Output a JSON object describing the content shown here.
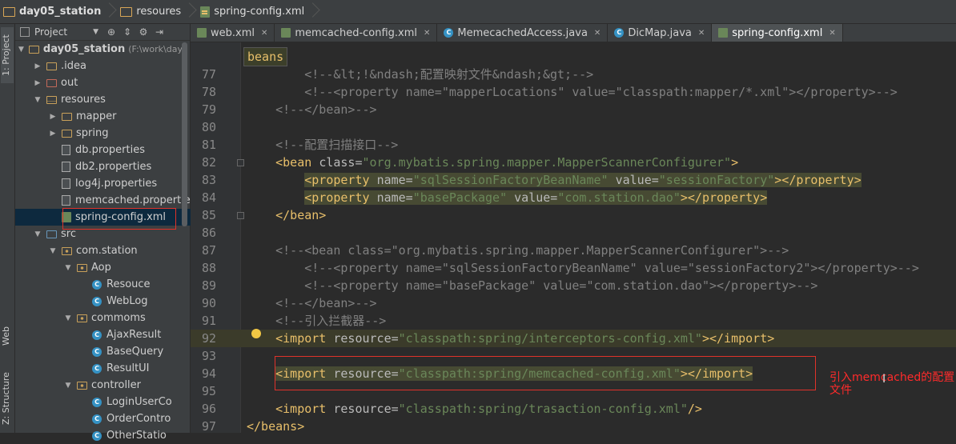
{
  "breadcrumb": {
    "project": "day05_station",
    "folder": "resoures",
    "file": "spring-config.xml"
  },
  "side_tabs": {
    "project": "1: Project",
    "web": "Web",
    "structure": "Z: Structure"
  },
  "project_panel": {
    "view_select": "Project",
    "tree": [
      {
        "label": "day05_station",
        "hint": "(F:\\work\\day0",
        "kind": "module",
        "arrow": "down"
      },
      {
        "label": ".idea",
        "kind": "folder",
        "arrow": "right"
      },
      {
        "label": "out",
        "kind": "out",
        "arrow": "right"
      },
      {
        "label": "resoures",
        "kind": "res",
        "arrow": "down"
      },
      {
        "label": "mapper",
        "kind": "folder",
        "arrow": "right"
      },
      {
        "label": "spring",
        "kind": "folder",
        "arrow": "right"
      },
      {
        "label": "db.properties",
        "kind": "prop",
        "arrow": "none"
      },
      {
        "label": "db2.properties",
        "kind": "prop",
        "arrow": "none"
      },
      {
        "label": "log4j.properties",
        "kind": "prop",
        "arrow": "none"
      },
      {
        "label": "memcached.propertie",
        "kind": "prop",
        "arrow": "none"
      },
      {
        "label": "spring-config.xml",
        "kind": "xml",
        "arrow": "none",
        "selected": true
      },
      {
        "label": "src",
        "kind": "src",
        "arrow": "down"
      },
      {
        "label": "com.station",
        "kind": "pkg",
        "arrow": "down"
      },
      {
        "label": "Aop",
        "kind": "pkg",
        "arrow": "down"
      },
      {
        "label": "Resouce",
        "kind": "class",
        "arrow": "none"
      },
      {
        "label": "WebLog",
        "kind": "class",
        "arrow": "none"
      },
      {
        "label": "commoms",
        "kind": "pkg",
        "arrow": "down"
      },
      {
        "label": "AjaxResult",
        "kind": "class",
        "arrow": "none"
      },
      {
        "label": "BaseQuery",
        "kind": "class",
        "arrow": "none"
      },
      {
        "label": "ResultUI",
        "kind": "class",
        "arrow": "none"
      },
      {
        "label": "controller",
        "kind": "pkg",
        "arrow": "down"
      },
      {
        "label": "LoginUserCo",
        "kind": "class",
        "arrow": "none"
      },
      {
        "label": "OrderContro",
        "kind": "class",
        "arrow": "none"
      },
      {
        "label": "OtherStatio",
        "kind": "class",
        "arrow": "none"
      }
    ]
  },
  "tabs": [
    {
      "label": "web.xml",
      "icon": "web-xml-icon",
      "active": false
    },
    {
      "label": "memcached-config.xml",
      "icon": "xml-file-icon",
      "active": false
    },
    {
      "label": "MemecachedAccess.java",
      "icon": "java-class-icon",
      "active": false
    },
    {
      "label": "DicMap.java",
      "icon": "java-class-icon",
      "active": false
    },
    {
      "label": "spring-config.xml",
      "icon": "xml-file-icon",
      "active": true
    }
  ],
  "editor": {
    "crumb": "beans",
    "lines": [
      {
        "n": "77",
        "segs": [
          [
            "cm",
            "        <!--&lt;!&ndash;配置映射文件&ndash;&gt;-->"
          ]
        ]
      },
      {
        "n": "78",
        "segs": [
          [
            "cm",
            "        <!--<property name=\"mapperLocations\" value=\"classpath:mapper/*.xml\"></property>-->"
          ]
        ]
      },
      {
        "n": "79",
        "segs": [
          [
            "cm",
            "    <!--</bean>-->"
          ]
        ]
      },
      {
        "n": "80",
        "segs": [
          [
            "cm",
            ""
          ]
        ]
      },
      {
        "n": "81",
        "segs": [
          [
            "cm",
            "    <!--配置扫描接口-->"
          ]
        ]
      },
      {
        "n": "82",
        "segs": [
          [
            "tg",
            "    <bean "
          ],
          [
            "at",
            "class="
          ],
          [
            "vl",
            "\"org.mybatis.spring.mapper.MapperScannerConfigurer\""
          ],
          [
            "tg",
            ">"
          ]
        ]
      },
      {
        "n": "83",
        "segs": [
          [
            "tg",
            "        <property "
          ],
          [
            "at",
            "name="
          ],
          [
            "vl",
            "\"sqlSessionFactoryBeanName\""
          ],
          [
            "at",
            " value="
          ],
          [
            "vl",
            "\"sessionFactory\""
          ],
          [
            "tg",
            "></property>"
          ]
        ],
        "box": true
      },
      {
        "n": "84",
        "segs": [
          [
            "tg",
            "        <property "
          ],
          [
            "at",
            "name="
          ],
          [
            "vl",
            "\"basePackage\""
          ],
          [
            "at",
            " value="
          ],
          [
            "vl",
            "\"com.station.dao\""
          ],
          [
            "tg",
            "></property>"
          ]
        ],
        "box": true
      },
      {
        "n": "85",
        "segs": [
          [
            "tg",
            "    </bean>"
          ]
        ]
      },
      {
        "n": "86",
        "segs": [
          [
            "cm",
            ""
          ]
        ]
      },
      {
        "n": "87",
        "segs": [
          [
            "cm",
            "    <!--<bean class=\"org.mybatis.spring.mapper.MapperScannerConfigurer\">-->"
          ]
        ]
      },
      {
        "n": "88",
        "segs": [
          [
            "cm",
            "        <!--<property name=\"sqlSessionFactoryBeanName\" value=\"sessionFactory2\"></property>-->"
          ]
        ]
      },
      {
        "n": "89",
        "segs": [
          [
            "cm",
            "        <!--<property name=\"basePackage\" value=\"com.station.dao\"></property>-->"
          ]
        ]
      },
      {
        "n": "90",
        "segs": [
          [
            "cm",
            "    <!--</bean>-->"
          ]
        ]
      },
      {
        "n": "91",
        "segs": [
          [
            "cm",
            "    <!--引入拦截器-->"
          ]
        ]
      },
      {
        "n": "92",
        "segs": [
          [
            "tg",
            "    <import "
          ],
          [
            "at",
            "resource="
          ],
          [
            "vl",
            "\"classpath:spring/interceptors-config.xml\""
          ],
          [
            "tg",
            "></import>"
          ]
        ],
        "hl": true
      },
      {
        "n": "93",
        "segs": [
          [
            "cm",
            ""
          ]
        ]
      },
      {
        "n": "94",
        "segs": [
          [
            "tg",
            "    <import "
          ],
          [
            "at",
            "resource="
          ],
          [
            "vl",
            "\"classpath:spring/memcached-config.xml\""
          ],
          [
            "tg",
            "></import>"
          ]
        ],
        "box": true
      },
      {
        "n": "95",
        "segs": [
          [
            "cm",
            ""
          ]
        ]
      },
      {
        "n": "96",
        "segs": [
          [
            "tg",
            "    <import "
          ],
          [
            "at",
            "resource="
          ],
          [
            "vl",
            "\"classpath:spring/trasaction-config.xml\""
          ],
          [
            "tg",
            "/>"
          ]
        ]
      },
      {
        "n": "97",
        "segs": [
          [
            "tg",
            "</beans>"
          ]
        ]
      }
    ]
  },
  "annotation": "引入memcached的配置文件",
  "colors": {
    "annotation_red": "#e0322a",
    "xml_tag": "#e8bf6a",
    "xml_value": "#6a8759",
    "comment": "#808080"
  }
}
